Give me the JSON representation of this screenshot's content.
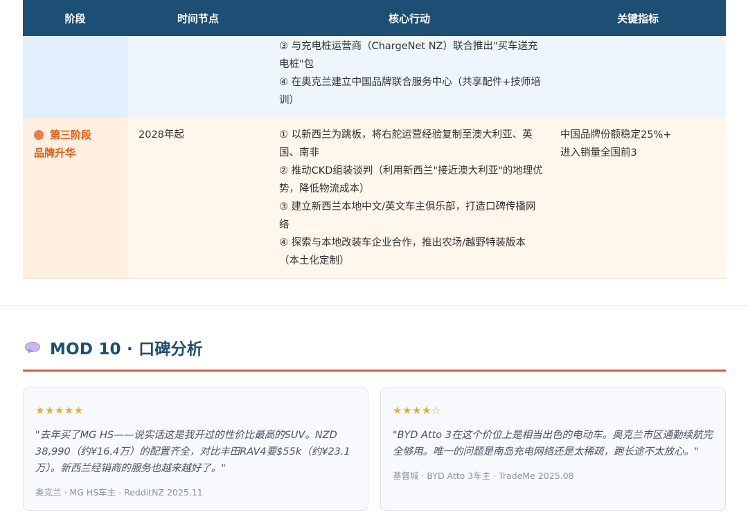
{
  "table": {
    "headers": [
      "阶段",
      "时间节点",
      "核心行动",
      "关键指标"
    ],
    "partial_row": {
      "actions": [
        "③ 与充电桩运营商（ChargeNet NZ）联合推出\"买车送充电桩\"包",
        "④ 在奥克兰建立中国品牌联合服务中心（共享配件+技师培训）"
      ]
    },
    "stage3": {
      "title": "第三阶段",
      "subtitle": "品牌升华",
      "time": "2028年起",
      "actions": [
        "① 以新西兰为跳板，将右舵运营经验复制至澳大利亚、英国、南非",
        "② 推动CKD组装谈判（利用新西兰\"接近澳大利亚\"的地理优势，降低物流成本）",
        "③ 建立新西兰本地中文/英文车主俱乐部，打造口碑传播网络",
        "④ 探索与本地改装车企业合作，推出农场/越野特装版本（本土化定制）"
      ],
      "metrics": [
        "中国品牌份额稳定25%+",
        "进入销量全国前3"
      ]
    }
  },
  "section": {
    "icon": "speech-bubble-icon",
    "title": "MOD 10 · 口碑分析",
    "rule_color": "#e05340"
  },
  "reviews": [
    {
      "stars": "★★★★★",
      "rating": 5,
      "quote": "\"去年买了MG HS——说实话这是我开过的性价比最高的SUV。NZD 38,990（约¥16.4万）的配置齐全，对比丰田RAV4要$55k（约¥23.1万）。新西兰经销商的服务也越来越好了。\"",
      "meta": "奥克兰 · MG HS车主 · RedditNZ 2025.11"
    },
    {
      "stars": "★★★★☆",
      "rating": 4,
      "quote": "\"BYD Atto 3在这个价位上是相当出色的电动车。奥克兰市区通勤续航完全够用。唯一的问题是南岛充电网络还是太稀疏，跑长途不太放心。\"",
      "meta": "基督城 · BYD Atto 3车主 · TradeMe 2025.08"
    }
  ],
  "colors": {
    "header_bg": "#1d4e73",
    "accent_orange": "#e8590c",
    "stars": "#f0a92a"
  }
}
